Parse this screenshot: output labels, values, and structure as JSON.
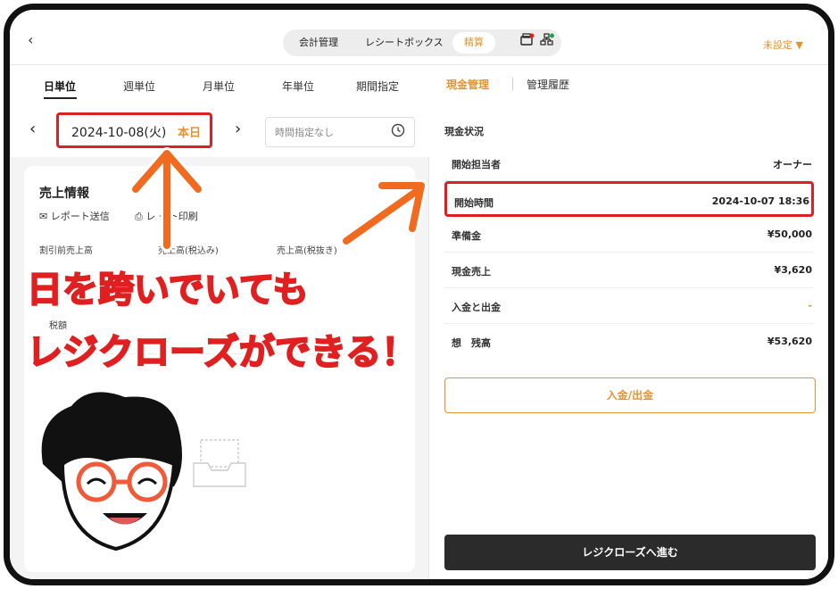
{
  "topbar": {
    "back_icon": "chevron-left-icon",
    "segments": [
      "会計管理",
      "レシートボックス",
      "精算"
    ],
    "active_segment": "精算",
    "unset_label": "未設定"
  },
  "left": {
    "tabs": [
      "日単位",
      "週単位",
      "月単位",
      "年単位",
      "期間指定"
    ],
    "date": "2024-10-08(火)",
    "today": "本日",
    "time_placeholder": "時間指定なし",
    "card": {
      "title": "売上情報",
      "send_report": "レポート送信",
      "print_report": "レ ート印刷",
      "columns": [
        "割引前売上高",
        "売上高(税込み)",
        "売上高(税抜き)"
      ],
      "fragments": [
        "税額"
      ]
    }
  },
  "right": {
    "tabs": [
      "現金管理",
      "管理履歴"
    ],
    "section": "現金状況",
    "rows": [
      {
        "key": "開始担当者",
        "value": "オーナー"
      },
      {
        "key": "開始時間",
        "value": "2024-10-07 18:36"
      },
      {
        "key": "準備金",
        "value": "¥50,000"
      },
      {
        "key": "現金売上",
        "value": "¥3,620"
      },
      {
        "key": "入金と出金",
        "value": "-"
      },
      {
        "key": "想　残高",
        "value": "¥53,620"
      }
    ],
    "io_button": "入金/出金",
    "close_button": "レジクローズへ進む"
  },
  "overlay": {
    "line1": "日を跨いでいても",
    "line2": "レジクローズができる！"
  },
  "colors": {
    "accent": "#e8922f",
    "highlight": "#e02020",
    "dark_button": "#2b2b2b"
  }
}
